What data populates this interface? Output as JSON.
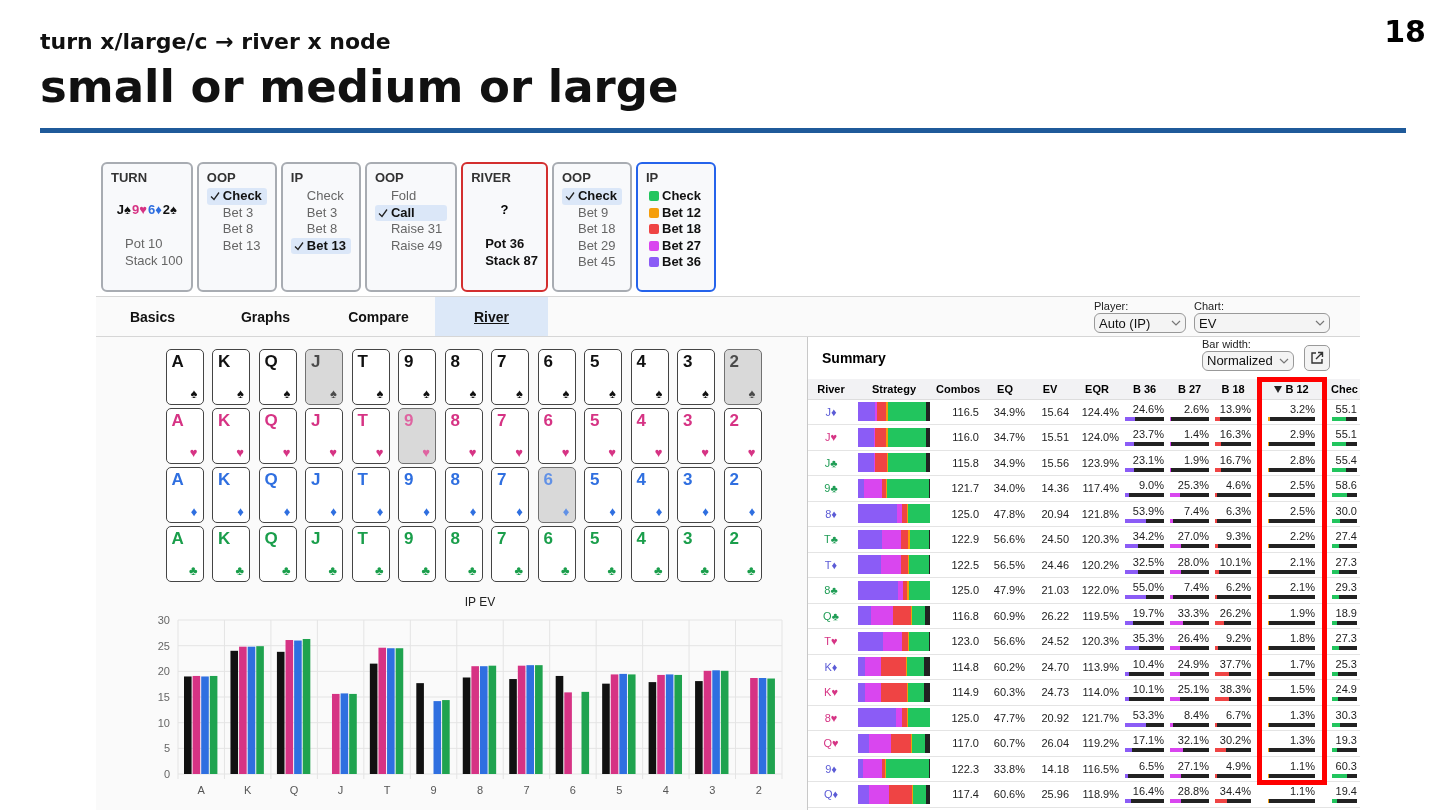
{
  "slide": {
    "subtitle": "turn x/large/c → river x node",
    "title": "small or medium or large",
    "page_number": "18"
  },
  "nodes": [
    {
      "kind": "street",
      "title": "TURN",
      "board": [
        {
          "rank": "J",
          "suit": "♠",
          "color": "#111111"
        },
        {
          "rank": "9",
          "suit": "♥",
          "color": "#d63384"
        },
        {
          "rank": "6",
          "suit": "♦",
          "color": "#2f6fe0"
        },
        {
          "rank": "2",
          "suit": "♠",
          "color": "#111111"
        }
      ],
      "lines": [
        "Pot 10",
        "Stack 100"
      ]
    },
    {
      "kind": "player",
      "title": "OOP",
      "options": [
        {
          "label": "Check",
          "selected": true
        },
        {
          "label": "Bet 3",
          "selected": false
        },
        {
          "label": "Bet 8",
          "selected": false
        },
        {
          "label": "Bet 13",
          "selected": false
        }
      ]
    },
    {
      "kind": "player",
      "title": "IP",
      "options": [
        {
          "label": "Check",
          "selected": false
        },
        {
          "label": "Bet 3",
          "selected": false
        },
        {
          "label": "Bet 8",
          "selected": false
        },
        {
          "label": "Bet 13",
          "selected": true
        }
      ]
    },
    {
      "kind": "player",
      "title": "OOP",
      "options": [
        {
          "label": "Fold",
          "selected": false
        },
        {
          "label": "Call",
          "selected": true
        },
        {
          "label": "Raise 31",
          "selected": false
        },
        {
          "label": "Raise 49",
          "selected": false
        }
      ]
    },
    {
      "kind": "street",
      "title": "RIVER",
      "color": "#d32f2f",
      "unknown": "?",
      "lines": [
        "Pot 36",
        "Stack 87"
      ]
    },
    {
      "kind": "player",
      "title": "OOP",
      "options": [
        {
          "label": "Check",
          "selected": true
        },
        {
          "label": "Bet 9",
          "selected": false
        },
        {
          "label": "Bet 18",
          "selected": false
        },
        {
          "label": "Bet 29",
          "selected": false
        },
        {
          "label": "Bet 45",
          "selected": false
        }
      ]
    },
    {
      "kind": "player",
      "title": "IP",
      "color": "#2563eb",
      "options": [
        {
          "label": "Check",
          "selected": false,
          "color": "#22c55e"
        },
        {
          "label": "Bet 12",
          "selected": false,
          "color": "#f59e0b"
        },
        {
          "label": "Bet 18",
          "selected": false,
          "color": "#ef4444"
        },
        {
          "label": "Bet 27",
          "selected": false,
          "color": "#d946ef"
        },
        {
          "label": "Bet 36",
          "selected": false,
          "color": "#8b5cf6"
        }
      ]
    }
  ],
  "tabs": [
    {
      "label": "Basics",
      "selected": false
    },
    {
      "label": "Graphs",
      "selected": false
    },
    {
      "label": "Compare",
      "selected": false
    },
    {
      "label": "River",
      "selected": true
    }
  ],
  "player_select": {
    "label": "Player:",
    "value": "Auto (IP)"
  },
  "chart_select": {
    "label": "Chart:",
    "value": "EV"
  },
  "card_grid": {
    "rows": [
      {
        "color": "#111111",
        "cards": [
          {
            "rank": "A",
            "suit": "♠",
            "used": false
          },
          {
            "rank": "K",
            "suit": "♠",
            "used": false
          },
          {
            "rank": "Q",
            "suit": "♠",
            "used": false
          },
          {
            "rank": "J",
            "suit": "♠",
            "used": true
          },
          {
            "rank": "T",
            "suit": "♠",
            "used": false
          },
          {
            "rank": "9",
            "suit": "♠",
            "used": false
          },
          {
            "rank": "8",
            "suit": "♠",
            "used": false
          },
          {
            "rank": "7",
            "suit": "♠",
            "used": false
          },
          {
            "rank": "6",
            "suit": "♠",
            "used": false
          },
          {
            "rank": "5",
            "suit": "♠",
            "used": false
          },
          {
            "rank": "4",
            "suit": "♠",
            "used": false
          },
          {
            "rank": "3",
            "suit": "♠",
            "used": false
          },
          {
            "rank": "2",
            "suit": "♠",
            "used": true
          }
        ]
      },
      {
        "color": "#d63384",
        "cards": [
          {
            "rank": "A",
            "suit": "♥",
            "used": false
          },
          {
            "rank": "K",
            "suit": "♥",
            "used": false
          },
          {
            "rank": "Q",
            "suit": "♥",
            "used": false
          },
          {
            "rank": "J",
            "suit": "♥",
            "used": false
          },
          {
            "rank": "T",
            "suit": "♥",
            "used": false
          },
          {
            "rank": "9",
            "suit": "♥",
            "used": true
          },
          {
            "rank": "8",
            "suit": "♥",
            "used": false
          },
          {
            "rank": "7",
            "suit": "♥",
            "used": false
          },
          {
            "rank": "6",
            "suit": "♥",
            "used": false
          },
          {
            "rank": "5",
            "suit": "♥",
            "used": false
          },
          {
            "rank": "4",
            "suit": "♥",
            "used": false
          },
          {
            "rank": "3",
            "suit": "♥",
            "used": false
          },
          {
            "rank": "2",
            "suit": "♥",
            "used": false
          }
        ]
      },
      {
        "color": "#2f6fe0",
        "cards": [
          {
            "rank": "A",
            "suit": "♦",
            "used": false
          },
          {
            "rank": "K",
            "suit": "♦",
            "used": false
          },
          {
            "rank": "Q",
            "suit": "♦",
            "used": false
          },
          {
            "rank": "J",
            "suit": "♦",
            "used": false
          },
          {
            "rank": "T",
            "suit": "♦",
            "used": false
          },
          {
            "rank": "9",
            "suit": "♦",
            "used": false
          },
          {
            "rank": "8",
            "suit": "♦",
            "used": false
          },
          {
            "rank": "7",
            "suit": "♦",
            "used": false
          },
          {
            "rank": "6",
            "suit": "♦",
            "used": true
          },
          {
            "rank": "5",
            "suit": "♦",
            "used": false
          },
          {
            "rank": "4",
            "suit": "♦",
            "used": false
          },
          {
            "rank": "3",
            "suit": "♦",
            "used": false
          },
          {
            "rank": "2",
            "suit": "♦",
            "used": false
          }
        ]
      },
      {
        "color": "#1a9e4b",
        "cards": [
          {
            "rank": "A",
            "suit": "♣",
            "used": false
          },
          {
            "rank": "K",
            "suit": "♣",
            "used": false
          },
          {
            "rank": "Q",
            "suit": "♣",
            "used": false
          },
          {
            "rank": "J",
            "suit": "♣",
            "used": false
          },
          {
            "rank": "T",
            "suit": "♣",
            "used": false
          },
          {
            "rank": "9",
            "suit": "♣",
            "used": false
          },
          {
            "rank": "8",
            "suit": "♣",
            "used": false
          },
          {
            "rank": "7",
            "suit": "♣",
            "used": false
          },
          {
            "rank": "6",
            "suit": "♣",
            "used": false
          },
          {
            "rank": "5",
            "suit": "♣",
            "used": false
          },
          {
            "rank": "4",
            "suit": "♣",
            "used": false
          },
          {
            "rank": "3",
            "suit": "♣",
            "used": false
          },
          {
            "rank": "2",
            "suit": "♣",
            "used": false
          }
        ]
      }
    ]
  },
  "ev_chart": {
    "chart_data": {
      "type": "bar",
      "title": "IP EV",
      "categories": [
        "A",
        "K",
        "Q",
        "J",
        "T",
        "9",
        "8",
        "7",
        "6",
        "5",
        "4",
        "3",
        "2"
      ],
      "ylim": [
        0,
        30
      ],
      "yticks": [
        0,
        5,
        10,
        15,
        20,
        25,
        30
      ],
      "grid": true,
      "series": [
        {
          "color": "#111111",
          "values": [
            19,
            24,
            23.8,
            null,
            21.5,
            17.7,
            18.8,
            18.5,
            19.1,
            17.6,
            17.9,
            18.1,
            null
          ]
        },
        {
          "color": "#d63384",
          "values": [
            19.1,
            24.8,
            26.1,
            15.6,
            24.6,
            null,
            21,
            21.1,
            15.9,
            19.4,
            19.3,
            20.1,
            18.7
          ]
        },
        {
          "color": "#2f6fe0",
          "values": [
            19,
            24.8,
            26,
            15.7,
            24.5,
            14.2,
            21,
            21.2,
            null,
            19.5,
            19.4,
            20.2,
            18.7
          ]
        },
        {
          "color": "#1fa34f",
          "values": [
            19.1,
            24.9,
            26.3,
            15.6,
            24.5,
            14.4,
            21.1,
            21.2,
            16,
            19.4,
            19.3,
            20.1,
            18.6
          ]
        }
      ]
    }
  },
  "summary": {
    "title": "Summary",
    "bar_width_select": {
      "label": "Bar width:",
      "value": "Normalized"
    }
  },
  "table": {
    "columns": [
      {
        "label": "River",
        "kind": "card"
      },
      {
        "label": "Strategy",
        "kind": "strategy"
      },
      {
        "label": "Combos",
        "kind": "num"
      },
      {
        "label": "EQ",
        "kind": "num"
      },
      {
        "label": "EV",
        "kind": "num"
      },
      {
        "label": "EQR",
        "kind": "num"
      },
      {
        "label": "B 36",
        "kind": "action",
        "color": "#8b5cf6",
        "sorted": false
      },
      {
        "label": "B 27",
        "kind": "action",
        "color": "#d946ef",
        "sorted": false
      },
      {
        "label": "B 18",
        "kind": "action",
        "color": "#ef4444",
        "sorted": false
      },
      {
        "label": "B 12",
        "kind": "action",
        "color": "#f59e0b",
        "sorted": true
      },
      {
        "label": "Chec",
        "kind": "action",
        "color": "#22c55e",
        "sorted": false
      }
    ],
    "rows": [
      {
        "cells": [
          {
            "rank": "J",
            "suit": "♦",
            "color": "#5b5bd6"
          },
          {
            "gap": {
              "level": 0.05
            }
          },
          "116.5",
          "34.9%",
          "15.64",
          "124.4%",
          {
            "value": "24.6%",
            "level": 0.246
          },
          {
            "value": "2.6%",
            "level": 0.026
          },
          {
            "value": "13.9%",
            "level": 0.139
          },
          {
            "value": "3.2%",
            "level": 0.032
          },
          {
            "value": "55.1",
            "level": 0.551
          }
        ]
      },
      {
        "cells": [
          {
            "rank": "J",
            "suit": "♥",
            "color": "#d63384"
          },
          {
            "gap": {
              "level": 0.05
            }
          },
          "116.0",
          "34.7%",
          "15.51",
          "124.0%",
          {
            "value": "23.7%",
            "level": 0.237
          },
          {
            "value": "1.4%",
            "level": 0.014
          },
          {
            "value": "16.3%",
            "level": 0.163
          },
          {
            "value": "2.9%",
            "level": 0.029
          },
          {
            "value": "55.1",
            "level": 0.551
          }
        ]
      },
      {
        "cells": [
          {
            "rank": "J",
            "suit": "♣",
            "color": "#1f9d55"
          },
          {
            "gap": {
              "level": 0.05
            }
          },
          "115.8",
          "34.9%",
          "15.56",
          "123.9%",
          {
            "value": "23.1%",
            "level": 0.231
          },
          {
            "value": "1.9%",
            "level": 0.019
          },
          {
            "value": "16.7%",
            "level": 0.167
          },
          {
            "value": "2.8%",
            "level": 0.028
          },
          {
            "value": "55.4",
            "level": 0.554
          }
        ]
      },
      {
        "cells": [
          {
            "rank": "9",
            "suit": "♣",
            "color": "#1f9d55"
          },
          {
            "gap": {
              "level": 0.01
            }
          },
          "121.7",
          "34.0%",
          "14.36",
          "117.4%",
          {
            "value": "9.0%",
            "level": 0.09
          },
          {
            "value": "25.3%",
            "level": 0.253
          },
          {
            "value": "4.6%",
            "level": 0.046
          },
          {
            "value": "2.5%",
            "level": 0.025
          },
          {
            "value": "58.6",
            "level": 0.586
          }
        ]
      },
      {
        "cells": [
          {
            "rank": "8",
            "suit": "♦",
            "color": "#5b5bd6"
          },
          {},
          "125.0",
          "47.8%",
          "20.94",
          "121.8%",
          {
            "value": "53.9%",
            "level": 0.539
          },
          {
            "value": "7.4%",
            "level": 0.074
          },
          {
            "value": "6.3%",
            "level": 0.063
          },
          {
            "value": "2.5%",
            "level": 0.025
          },
          {
            "value": "30.0",
            "level": 0.3
          }
        ]
      },
      {
        "cells": [
          {
            "rank": "T",
            "suit": "♣",
            "color": "#1f9d55"
          },
          {
            "gap": {
              "level": 0.015
            }
          },
          "122.9",
          "56.6%",
          "24.50",
          "120.3%",
          {
            "value": "34.2%",
            "level": 0.342
          },
          {
            "value": "27.0%",
            "level": 0.27
          },
          {
            "value": "9.3%",
            "level": 0.093
          },
          {
            "value": "2.2%",
            "level": 0.022
          },
          {
            "value": "27.4",
            "level": 0.274
          }
        ]
      },
      {
        "cells": [
          {
            "rank": "T",
            "suit": "♦",
            "color": "#5b5bd6"
          },
          {
            "gap": {
              "level": 0.02
            }
          },
          "122.5",
          "56.5%",
          "24.46",
          "120.2%",
          {
            "value": "32.5%",
            "level": 0.325
          },
          {
            "value": "28.0%",
            "level": 0.28
          },
          {
            "value": "10.1%",
            "level": 0.101
          },
          {
            "value": "2.1%",
            "level": 0.021
          },
          {
            "value": "27.3",
            "level": 0.273
          }
        ]
      },
      {
        "cells": [
          {
            "rank": "8",
            "suit": "♣",
            "color": "#1f9d55"
          },
          {},
          "125.0",
          "47.9%",
          "21.03",
          "122.0%",
          {
            "value": "55.0%",
            "level": 0.55
          },
          {
            "value": "7.4%",
            "level": 0.074
          },
          {
            "value": "6.2%",
            "level": 0.062
          },
          {
            "value": "2.1%",
            "level": 0.021
          },
          {
            "value": "29.3",
            "level": 0.293
          }
        ]
      },
      {
        "cells": [
          {
            "rank": "Q",
            "suit": "♣",
            "color": "#1f9d55"
          },
          {
            "gap": {
              "level": 0.07
            }
          },
          "116.8",
          "60.9%",
          "26.22",
          "119.5%",
          {
            "value": "19.7%",
            "level": 0.197
          },
          {
            "value": "33.3%",
            "level": 0.333
          },
          {
            "value": "26.2%",
            "level": 0.262
          },
          {
            "value": "1.9%",
            "level": 0.019
          },
          {
            "value": "18.9",
            "level": 0.189
          }
        ]
      },
      {
        "cells": [
          {
            "rank": "T",
            "suit": "♥",
            "color": "#d63384"
          },
          {
            "gap": {
              "level": 0.02
            }
          },
          "123.0",
          "56.6%",
          "24.52",
          "120.3%",
          {
            "value": "35.3%",
            "level": 0.353
          },
          {
            "value": "26.4%",
            "level": 0.264
          },
          {
            "value": "9.2%",
            "level": 0.092
          },
          {
            "value": "1.8%",
            "level": 0.018
          },
          {
            "value": "27.3",
            "level": 0.273
          }
        ]
      },
      {
        "cells": [
          {
            "rank": "K",
            "suit": "♦",
            "color": "#5b5bd6"
          },
          {
            "gap": {
              "level": 0.08
            }
          },
          "114.8",
          "60.2%",
          "24.70",
          "113.9%",
          {
            "value": "10.4%",
            "level": 0.104
          },
          {
            "value": "24.9%",
            "level": 0.249
          },
          {
            "value": "37.7%",
            "level": 0.377
          },
          {
            "value": "1.7%",
            "level": 0.017
          },
          {
            "value": "25.3",
            "level": 0.253
          }
        ]
      },
      {
        "cells": [
          {
            "rank": "K",
            "suit": "♥",
            "color": "#d63384"
          },
          {
            "gap": {
              "level": 0.08
            }
          },
          "114.9",
          "60.3%",
          "24.73",
          "114.0%",
          {
            "value": "10.1%",
            "level": 0.101
          },
          {
            "value": "25.1%",
            "level": 0.251
          },
          {
            "value": "38.3%",
            "level": 0.383
          },
          {
            "value": "1.5%",
            "level": 0.015
          },
          {
            "value": "24.9",
            "level": 0.249
          }
        ]
      },
      {
        "cells": [
          {
            "rank": "8",
            "suit": "♥",
            "color": "#d63384"
          },
          {},
          "125.0",
          "47.7%",
          "20.92",
          "121.7%",
          {
            "value": "53.3%",
            "level": 0.533
          },
          {
            "value": "8.4%",
            "level": 0.084
          },
          {
            "value": "6.7%",
            "level": 0.067
          },
          {
            "value": "1.3%",
            "level": 0.013
          },
          {
            "value": "30.3",
            "level": 0.303
          }
        ]
      },
      {
        "cells": [
          {
            "rank": "Q",
            "suit": "♥",
            "color": "#d63384"
          },
          {
            "gap": {
              "level": 0.07
            }
          },
          "117.0",
          "60.7%",
          "26.04",
          "119.2%",
          {
            "value": "17.1%",
            "level": 0.171
          },
          {
            "value": "32.1%",
            "level": 0.321
          },
          {
            "value": "30.2%",
            "level": 0.302
          },
          {
            "value": "1.3%",
            "level": 0.013
          },
          {
            "value": "19.3",
            "level": 0.193
          }
        ]
      },
      {
        "cells": [
          {
            "rank": "9",
            "suit": "♦",
            "color": "#5b5bd6"
          },
          {
            "gap": {
              "level": 0.01
            }
          },
          "122.3",
          "33.8%",
          "14.18",
          "116.5%",
          {
            "value": "6.5%",
            "level": 0.065
          },
          {
            "value": "27.1%",
            "level": 0.271
          },
          {
            "value": "4.9%",
            "level": 0.049
          },
          {
            "value": "1.1%",
            "level": 0.011
          },
          {
            "value": "60.3",
            "level": 0.603
          }
        ]
      },
      {
        "cells": [
          {
            "rank": "Q",
            "suit": "♦",
            "color": "#5b5bd6"
          },
          {
            "gap": {
              "level": 0.06
            }
          },
          "117.4",
          "60.6%",
          "25.96",
          "118.9%",
          {
            "value": "16.4%",
            "level": 0.164
          },
          {
            "value": "28.8%",
            "level": 0.288
          },
          {
            "value": "34.4%",
            "level": 0.344
          },
          {
            "value": "1.1%",
            "level": 0.011
          },
          {
            "value": "19.4",
            "level": 0.194
          }
        ]
      }
    ]
  }
}
